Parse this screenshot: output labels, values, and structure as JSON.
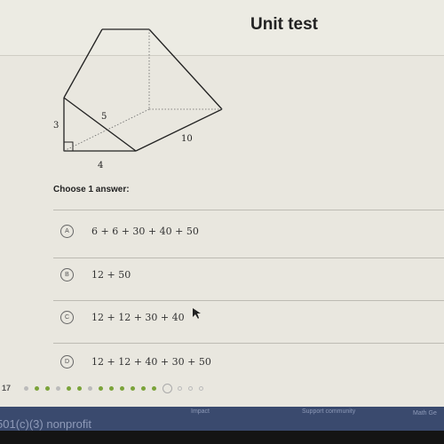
{
  "header": {
    "title": "Unit test"
  },
  "figure": {
    "labels": {
      "height": "3",
      "hyp": "5",
      "length": "10",
      "base": "4"
    }
  },
  "question": {
    "prompt": "Choose 1 answer:",
    "options": [
      {
        "letter": "A",
        "text": "6 + 6 + 30 + 40 + 50"
      },
      {
        "letter": "B",
        "text": "12 + 50"
      },
      {
        "letter": "C",
        "text": "12 + 12 + 30 + 40"
      },
      {
        "letter": "D",
        "text": "12 + 12 + 40 + 30 + 50"
      }
    ]
  },
  "progress": {
    "question_number": "17",
    "dots": [
      "skipped",
      "correct",
      "correct",
      "skipped",
      "correct",
      "correct",
      "skipped",
      "correct",
      "correct",
      "correct",
      "correct",
      "correct",
      "correct",
      "current",
      "pending",
      "pending",
      "pending"
    ],
    "colors": {
      "correct": "#7ba33a",
      "skipped": "#bbbbbb"
    }
  },
  "footer": {
    "nonprofit": "501(c)(3) nonprofit",
    "links": [
      "Impact",
      "Support community",
      "Math Ge"
    ]
  }
}
